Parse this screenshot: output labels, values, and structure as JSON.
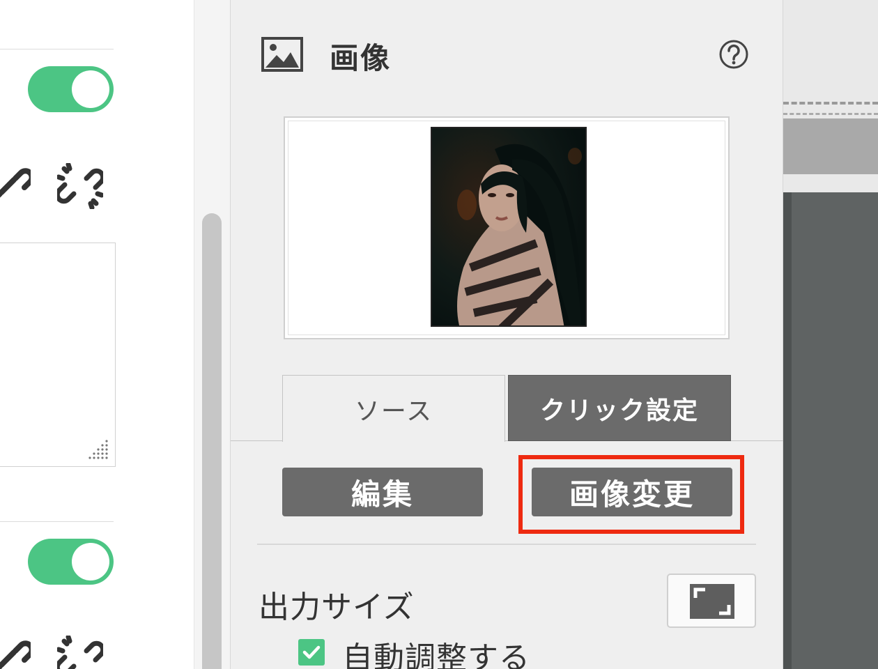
{
  "panel": {
    "title": "画像",
    "title_icon": "image-icon",
    "help_icon": "help-circle-icon"
  },
  "preview": {
    "alt": "woman-portrait-photo"
  },
  "tabs": [
    {
      "label": "ソース",
      "active": true
    },
    {
      "label": "クリック設定",
      "active": false
    }
  ],
  "buttons": {
    "edit_label": "編集",
    "change_label": "画像変更"
  },
  "output_size": {
    "label": "出力サイズ",
    "fullscreen_icon": "expand-icon",
    "auto_adjust_label": "自動調整する",
    "auto_adjust_checked": true
  },
  "left": {
    "toggle1_on": true,
    "toggle2_on": true,
    "icons": [
      "link-icon",
      "unlink-icon"
    ]
  },
  "colors": {
    "toggle_green": "#4cc584",
    "button_gray": "#6b6b6b",
    "highlight_red": "#ee2a10"
  }
}
